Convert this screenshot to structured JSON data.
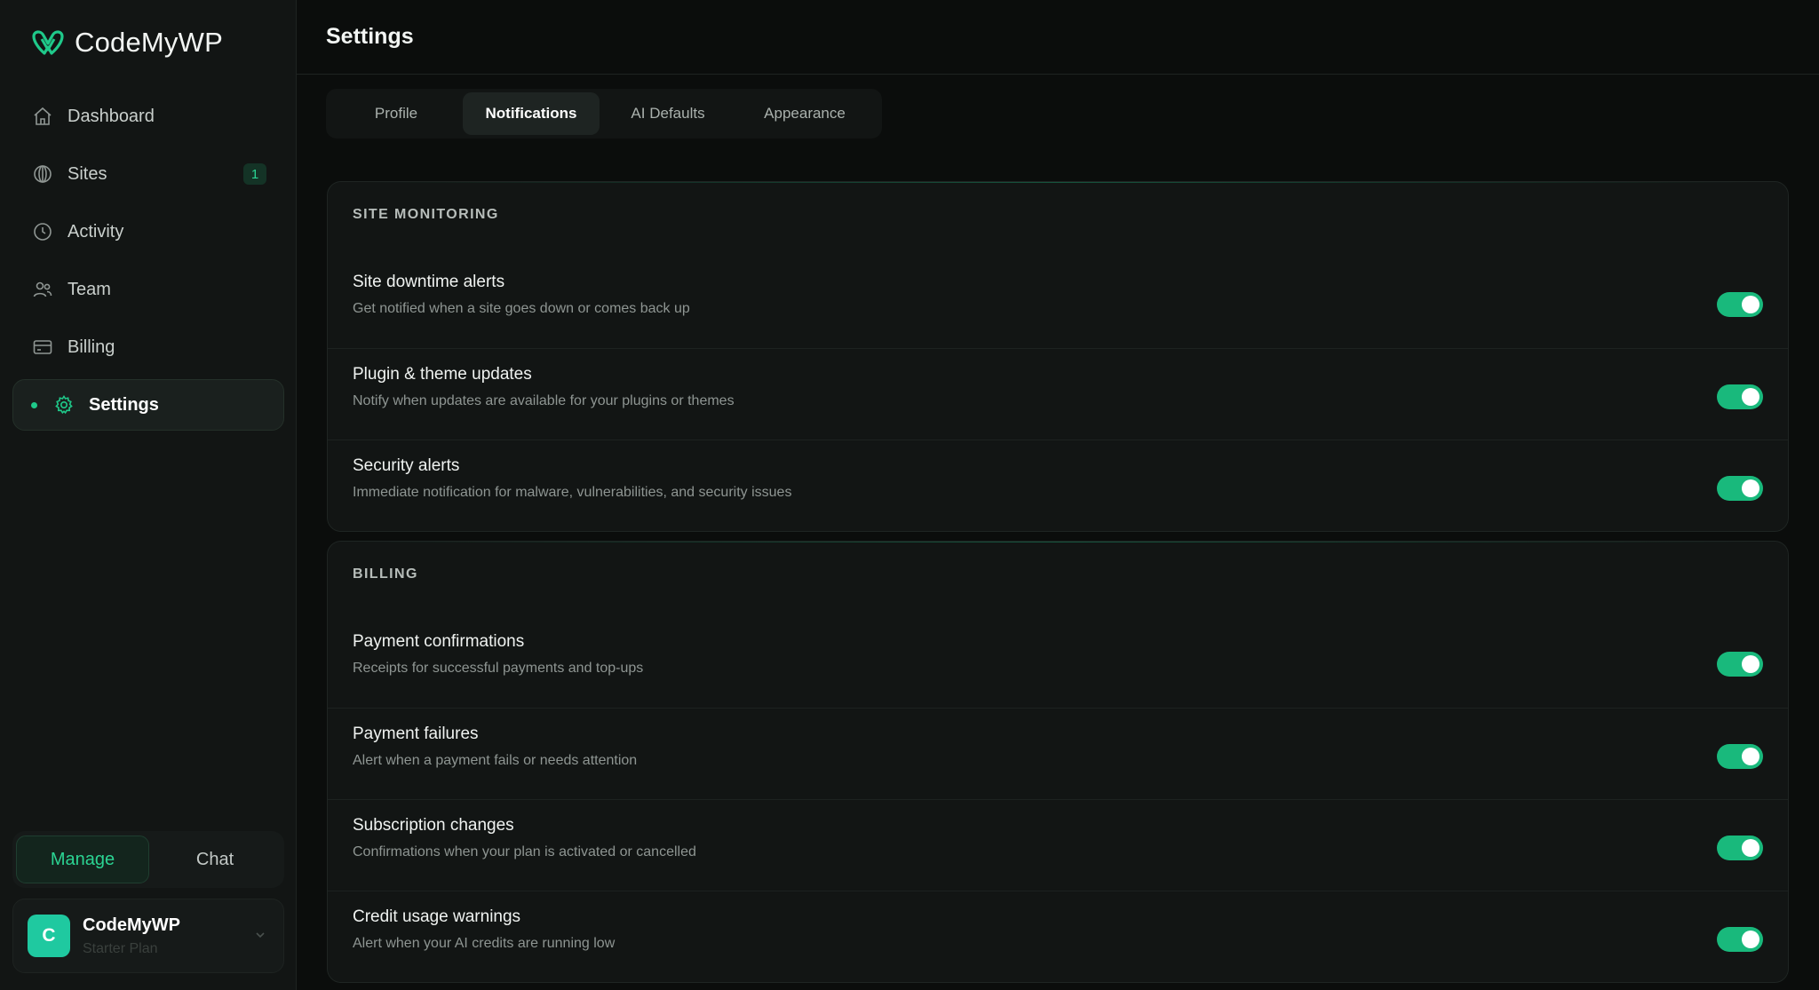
{
  "brand": {
    "name": "CodeMyWP",
    "accent": "#1fc98a"
  },
  "sidebar": {
    "items": [
      {
        "label": "Dashboard",
        "icon": "home-icon"
      },
      {
        "label": "Sites",
        "icon": "globe-icon",
        "badge": "1"
      },
      {
        "label": "Activity",
        "icon": "clock-icon"
      },
      {
        "label": "Team",
        "icon": "users-icon"
      },
      {
        "label": "Billing",
        "icon": "credit-card-icon"
      },
      {
        "label": "Settings",
        "icon": "gear-icon",
        "active": true
      }
    ],
    "mode": {
      "manage": "Manage",
      "chat": "Chat",
      "active": "Manage"
    },
    "account": {
      "initial": "C",
      "name": "CodeMyWP",
      "plan": "Starter Plan"
    }
  },
  "header": {
    "title": "Settings"
  },
  "tabs": [
    {
      "label": "Profile"
    },
    {
      "label": "Notifications",
      "active": true
    },
    {
      "label": "AI Defaults"
    },
    {
      "label": "Appearance"
    }
  ],
  "sections": [
    {
      "title": "SITE MONITORING",
      "rows": [
        {
          "title": "Site downtime alerts",
          "desc": "Get notified when a site goes down or comes back up",
          "enabled": true
        },
        {
          "title": "Plugin & theme updates",
          "desc": "Notify when updates are available for your plugins or themes",
          "enabled": true
        },
        {
          "title": "Security alerts",
          "desc": "Immediate notification for malware, vulnerabilities, and security issues",
          "enabled": true
        }
      ]
    },
    {
      "title": "BILLING",
      "rows": [
        {
          "title": "Payment confirmations",
          "desc": "Receipts for successful payments and top-ups",
          "enabled": true
        },
        {
          "title": "Payment failures",
          "desc": "Alert when a payment fails or needs attention",
          "enabled": true
        },
        {
          "title": "Subscription changes",
          "desc": "Confirmations when your plan is activated or cancelled",
          "enabled": true
        },
        {
          "title": "Credit usage warnings",
          "desc": "Alert when your AI credits are running low",
          "enabled": true
        }
      ]
    }
  ]
}
